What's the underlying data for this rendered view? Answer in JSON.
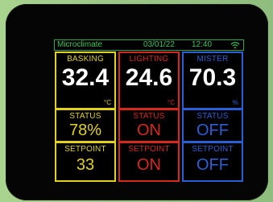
{
  "header": {
    "app_name": "Microclimate",
    "date": "03/01/22",
    "time": "12:40"
  },
  "panels": [
    {
      "key": "basking",
      "title": "BASKING",
      "reading": "32.4",
      "unit": "°C",
      "status_label": "STATUS",
      "status_value": "78%",
      "setpoint_label": "SETPOINT",
      "setpoint_value": "33",
      "color": "#e2d21c"
    },
    {
      "key": "lighting",
      "title": "LIGHTING",
      "reading": "24.6",
      "unit": "°C",
      "status_label": "STATUS",
      "status_value": "ON",
      "setpoint_label": "SETPOINT",
      "setpoint_value": "ON",
      "color": "#d6281f"
    },
    {
      "key": "mister",
      "title": "MISTER",
      "reading": "70.3",
      "unit": "%",
      "status_label": "STATUS",
      "status_value": "OFF",
      "setpoint_label": "SETPOINT",
      "setpoint_value": "OFF",
      "color": "#2a5fd6"
    }
  ],
  "icons": {
    "wifi": "wifi-icon"
  },
  "colors": {
    "header_green": "#37c75a",
    "reading_white": "#ffffff",
    "screen_bg": "#000000",
    "bezel": "#050505"
  }
}
